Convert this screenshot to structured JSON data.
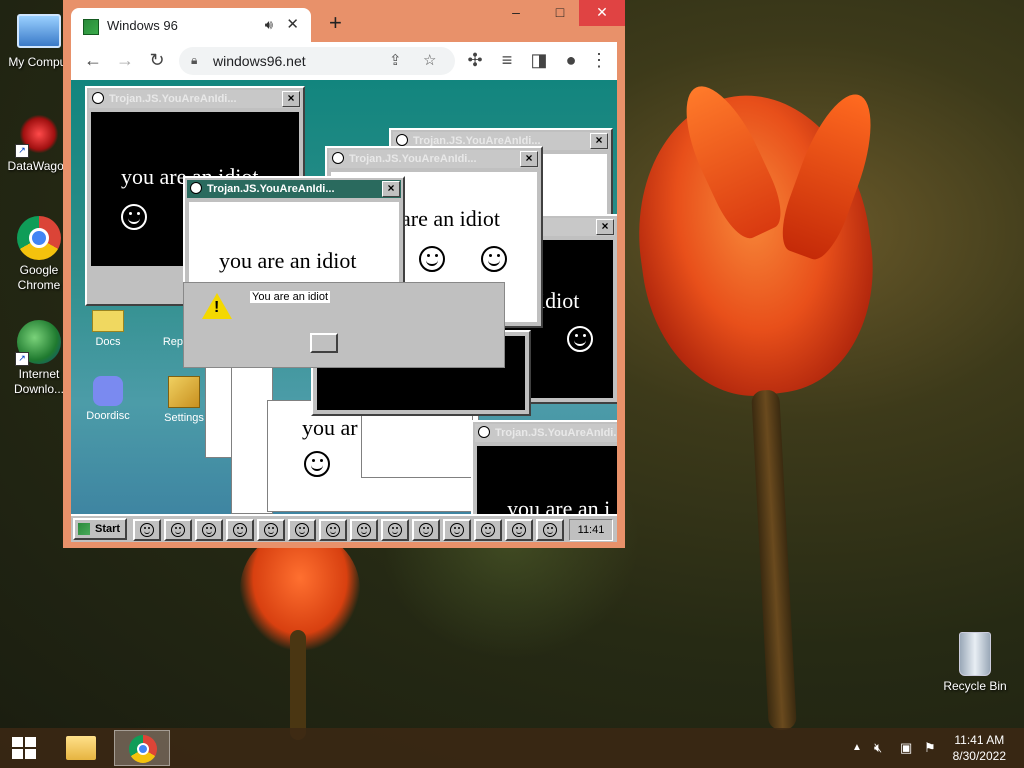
{
  "desktop": {
    "icons": [
      {
        "label": "My Comput",
        "icon": "computer-icon"
      },
      {
        "label": "DataWagon",
        "icon": "datawagon-icon"
      },
      {
        "label": "Google Chrome",
        "icon": "chrome-icon"
      },
      {
        "label": "Internet Downlo...",
        "icon": "idm-icon"
      },
      {
        "label": "Recycle Bin",
        "icon": "recycle-bin-icon"
      }
    ]
  },
  "browser": {
    "tab_title": "Windows 96",
    "url": "windows96.net",
    "new_tab": "+",
    "controls": {
      "minimize": "–",
      "maximize": "□",
      "close": "✕"
    }
  },
  "w96": {
    "popup_title": "Trojan.JS.YouAreAnIdi...",
    "popup_title_faded": "Trojan.JS.YouAreAnIdi...",
    "message": "you are an idiot",
    "fragments": {
      "idiot_partial_1": "are an idiot",
      "idiot_partial_2": "idiot",
      "idiot_partial_3": "you ar",
      "idiot_partial_4": "you are an i"
    },
    "alert_text": "You are an idiot",
    "desktop_icons": [
      {
        "label": "Docs"
      },
      {
        "label": "Repo"
      },
      {
        "label": "Doordisc"
      },
      {
        "label": "Settings"
      }
    ],
    "start_label": "Start",
    "clock": "11:41"
  },
  "taskbar": {
    "time": "11:41 AM",
    "date": "8/30/2022",
    "tray_icons": [
      "chevron-up-icon",
      "muted-speaker-icon",
      "network-icon",
      "flag-icon"
    ]
  }
}
